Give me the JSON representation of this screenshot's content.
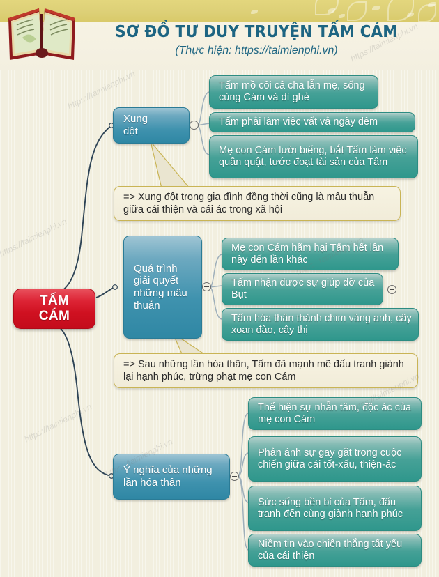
{
  "header": {
    "title": "SƠ ĐỒ TƯ DUY TRUYỆN TẤM CÁM",
    "subtitle": "(Thực hiện: https://taimienphi.vn)",
    "book_icon": "open-book-icon",
    "band_color": "#ddd077",
    "title_color": "#1d6582"
  },
  "watermark": {
    "text": "https://taimienphi.vn"
  },
  "colors": {
    "background": "#f2efdf",
    "central_node": "#cf1020",
    "branch_node": "#3f92ae",
    "leaf_node": "#46a197",
    "callout_border": "#c9b455",
    "connector": "#2e4456"
  },
  "mindmap": {
    "central": {
      "label": "TẤM\nCÁM",
      "line1": "TẤM",
      "line2": "CÁM"
    },
    "branches": [
      {
        "id": "xung-dot",
        "label": "Xung\nđột",
        "toggle": "minus",
        "leaves": [
          {
            "text": "Tấm mồ côi cả cha lẫn mẹ, sống cùng Cám và dì ghẻ"
          },
          {
            "text": "Tấm phải làm việc vất vả ngày đêm"
          },
          {
            "text": "Mẹ con Cám lười biếng, bắt Tấm làm việc quần quật, tước đoạt tài sản của Tấm"
          }
        ],
        "callout": "=> Xung đột trong gia đình đồng thời cũng là mâu thuẫn giữa cái thiện và cái ác trong xã hội"
      },
      {
        "id": "qua-trinh-giai-quyet",
        "label": "Quá trình giải quyết những mâu thuẫn",
        "toggle": "minus",
        "leaves": [
          {
            "text": "Mẹ con Cám hãm hại Tấm hết lần này đến lần khác"
          },
          {
            "text": "Tấm nhận được sự giúp đỡ của Bụt",
            "toggle_right": "plus"
          },
          {
            "text": "Tấm hóa thân thành chim vàng anh, cây xoan đào, cây thị"
          }
        ],
        "callout": "=> Sau những lần hóa thân, Tấm đã mạnh mẽ đấu tranh giành lại hạnh phúc, trừng phạt mẹ con Cám"
      },
      {
        "id": "y-nghia-hoa-than",
        "label": "Ý nghĩa của những lần hóa thân",
        "toggle": "minus",
        "leaves": [
          {
            "text": "Thể hiện sự nhẫn tâm, độc ác của mẹ con Cám"
          },
          {
            "text": "Phản ánh sự gay gắt trong cuộc chiến giữa cái tốt-xấu, thiện-ác"
          },
          {
            "text": "Sức sống bền bỉ của Tấm, đấu tranh đến cùng giành hạnh phúc"
          },
          {
            "text": "Niềm tin vào chiến thắng tất yếu của cái thiện"
          }
        ],
        "callout": null
      }
    ]
  }
}
